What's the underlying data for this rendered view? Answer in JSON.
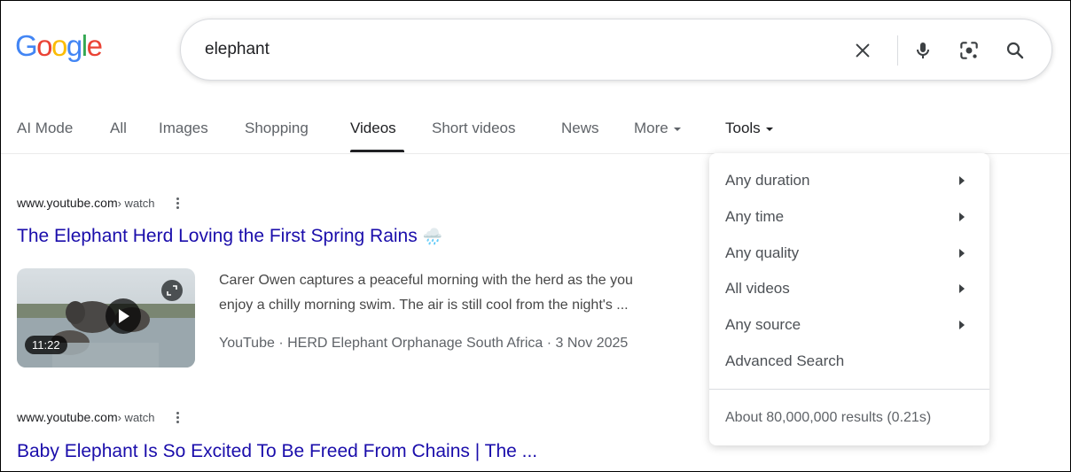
{
  "logo": {
    "letters": [
      "G",
      "o",
      "o",
      "g",
      "l",
      "e"
    ],
    "colors": [
      "#4285F4",
      "#EA4335",
      "#FBBC05",
      "#4285F4",
      "#34A853",
      "#EA4335"
    ]
  },
  "search": {
    "query": "elephant",
    "icons": [
      "close-icon",
      "microphone-icon",
      "lens-icon",
      "search-icon"
    ]
  },
  "tabs": [
    {
      "label": "AI Mode"
    },
    {
      "label": "All"
    },
    {
      "label": "Images"
    },
    {
      "label": "Shopping"
    },
    {
      "label": "Videos",
      "active": true
    },
    {
      "label": "Short videos"
    },
    {
      "label": "News"
    },
    {
      "label": "More"
    },
    {
      "label": "Tools"
    }
  ],
  "results": [
    {
      "domain": "www.youtube.com",
      "path": " › watch",
      "title": "The Elephant Herd Loving the First Spring Rains",
      "title_emoji": "🌧️",
      "snippet_line1": "Carer Owen captures a peaceful morning with the herd as the you",
      "snippet_line2": "enjoy a chilly morning swim. The air is still cool from the night's ...",
      "meta": "YouTube · HERD Elephant Orphanage South Africa · 3 Nov 2025",
      "duration": "11:22"
    },
    {
      "domain": "www.youtube.com",
      "path": " › watch",
      "title": "Baby Elephant Is So Excited To Be Freed From Chains | The ..."
    }
  ],
  "tools_menu": {
    "items": [
      {
        "label": "Any duration",
        "submenu": true
      },
      {
        "label": "Any time",
        "submenu": true
      },
      {
        "label": "Any quality",
        "submenu": true
      },
      {
        "label": "All videos",
        "submenu": true
      },
      {
        "label": "Any source",
        "submenu": true
      },
      {
        "label": "Advanced Search",
        "submenu": false
      }
    ],
    "stats": "About 80,000,000 results (0.21s)"
  },
  "colors": {
    "link": "#1a0dab",
    "text": "#202124",
    "muted": "#5f6368"
  }
}
